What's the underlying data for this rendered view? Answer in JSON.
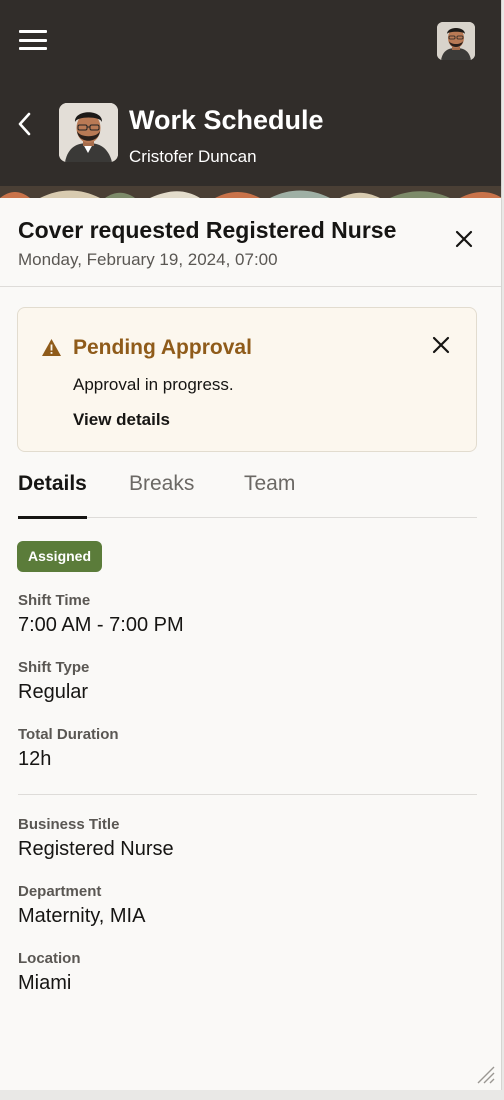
{
  "header": {
    "title": "Work Schedule",
    "subtitle": "Cristofer Duncan"
  },
  "record": {
    "title": "Cover requested Registered Nurse",
    "date": "Monday, February 19, 2024, 07:00"
  },
  "banner": {
    "title": "Pending Approval",
    "message": "Approval in progress.",
    "link": "View details",
    "color": "#8f5b1a"
  },
  "tabs": [
    {
      "label": "Details",
      "active": true
    },
    {
      "label": "Breaks",
      "active": false
    },
    {
      "label": "Team",
      "active": false
    }
  ],
  "status_badge": {
    "label": "Assigned",
    "color": "#5b7c3a"
  },
  "fields": {
    "shift_time": {
      "label": "Shift Time",
      "value": "7:00 AM - 7:00 PM"
    },
    "shift_type": {
      "label": "Shift Type",
      "value": "Regular"
    },
    "total_duration": {
      "label": "Total Duration",
      "value": "12h"
    },
    "business_title": {
      "label": "Business Title",
      "value": "Registered Nurse"
    },
    "department": {
      "label": "Department",
      "value": "Maternity, MIA"
    },
    "location": {
      "label": "Location",
      "value": "Miami"
    }
  },
  "icons": [
    "hamburger-menu-icon",
    "back-chevron-icon",
    "close-icon",
    "warning-icon",
    "resize-grip-icon"
  ],
  "colors": {
    "header_bg": "#312d2a",
    "page_bg": "#faf9f7"
  }
}
